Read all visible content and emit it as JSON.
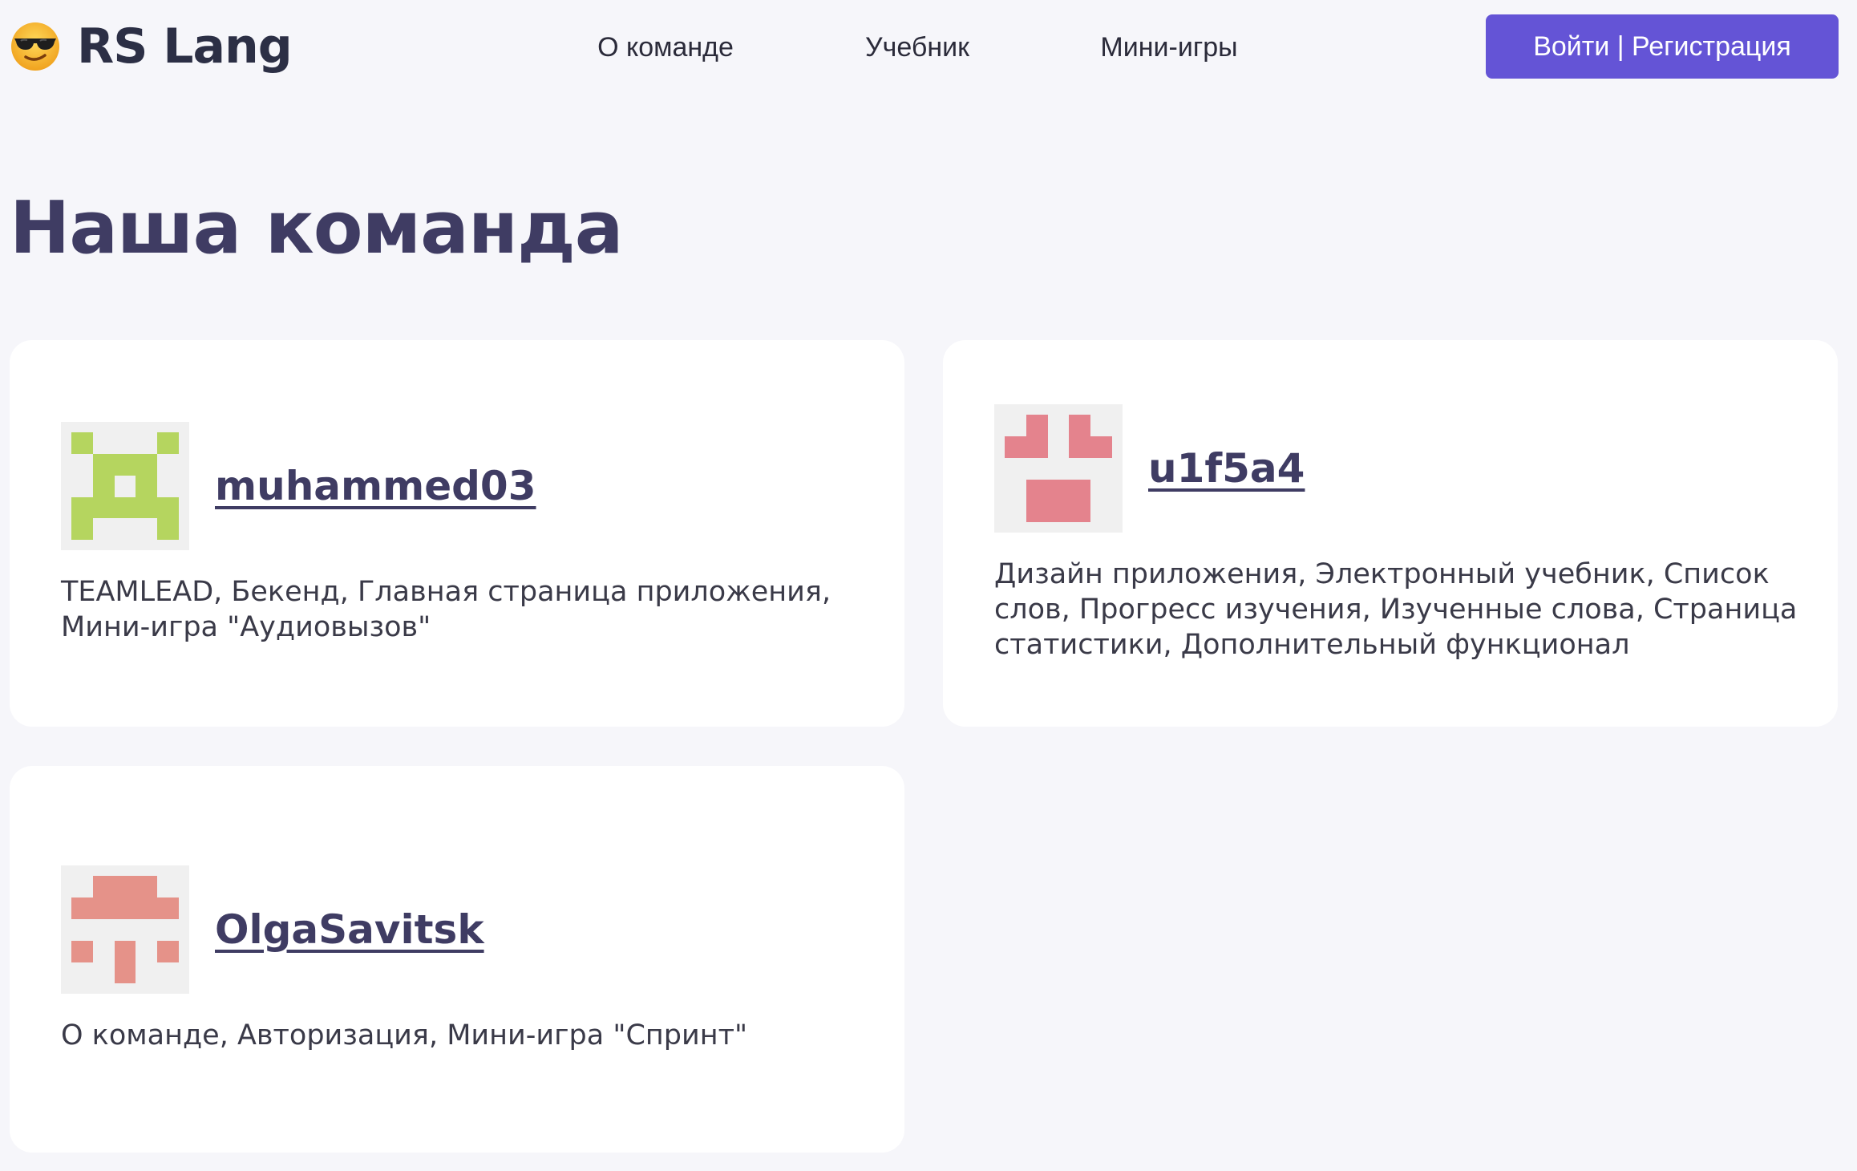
{
  "header": {
    "brand": "RS Lang",
    "logo_icon": "sunglasses-emoji-icon",
    "nav": {
      "about": "О команде",
      "textbook": "Учебник",
      "games": "Мини-игры"
    },
    "login_label": "Войти | Регистрация",
    "accent_color": "#6454d6"
  },
  "page": {
    "title": "Наша команда",
    "background_color": "#f6f6fa",
    "title_color": "#3f3c63"
  },
  "members": [
    {
      "name": "muhammed03",
      "roles": "TEAMLEAD, Бекенд, Главная страница приложения, Мини-игра \"Аудиовызов\"",
      "avatar_icon": "identicon-avatar-icon",
      "avatar_color": "#b5d55f"
    },
    {
      "name": "u1f5a4",
      "roles": "Дизайн приложения, Электронный учебник, Список слов, Прогресс изучения, Изученные слова, Страница статистики, Дополнительный функционал",
      "avatar_icon": "identicon-avatar-icon",
      "avatar_color": "#e4838d"
    },
    {
      "name": "OlgaSavitsk",
      "roles": "О команде, Авторизация, Мини-игра \"Спринт\"",
      "avatar_icon": "identicon-avatar-icon",
      "avatar_color": "#e59289"
    }
  ]
}
